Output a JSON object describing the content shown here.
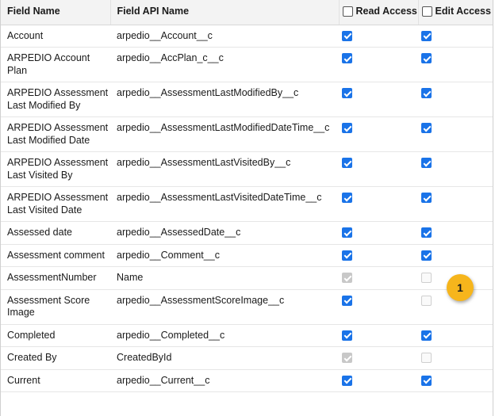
{
  "header": {
    "field_name": "Field Name",
    "field_api_name": "Field API Name",
    "read_access": "Read Access",
    "edit_access": "Edit Access"
  },
  "rows": [
    {
      "name": "Account",
      "api": "arpedio__Account__c",
      "read": true,
      "edit": true,
      "read_disabled": false,
      "edit_disabled": false
    },
    {
      "name": "ARPEDIO Account Plan",
      "api": "arpedio__AccPlan_c__c",
      "read": true,
      "edit": true,
      "read_disabled": false,
      "edit_disabled": false
    },
    {
      "name": "ARPEDIO Assessment Last Modified By",
      "api": "arpedio__AssessmentLastModifiedBy__c",
      "read": true,
      "edit": true,
      "read_disabled": false,
      "edit_disabled": false
    },
    {
      "name": "ARPEDIO Assessment Last Modified Date",
      "api": "arpedio__AssessmentLastModifiedDateTime__c",
      "read": true,
      "edit": true,
      "read_disabled": false,
      "edit_disabled": false
    },
    {
      "name": "ARPEDIO Assessment Last Visited By",
      "api": "arpedio__AssessmentLastVisitedBy__c",
      "read": true,
      "edit": true,
      "read_disabled": false,
      "edit_disabled": false
    },
    {
      "name": "ARPEDIO Assessment Last Visited Date",
      "api": "arpedio__AssessmentLastVisitedDateTime__c",
      "read": true,
      "edit": true,
      "read_disabled": false,
      "edit_disabled": false
    },
    {
      "name": "Assessed date",
      "api": "arpedio__AssessedDate__c",
      "read": true,
      "edit": true,
      "read_disabled": false,
      "edit_disabled": false
    },
    {
      "name": "Assessment comment",
      "api": "arpedio__Comment__c",
      "read": true,
      "edit": true,
      "read_disabled": false,
      "edit_disabled": false
    },
    {
      "name": "AssessmentNumber",
      "api": "Name",
      "read": true,
      "edit": false,
      "read_disabled": true,
      "edit_disabled": true
    },
    {
      "name": "Assessment Score Image",
      "api": "arpedio__AssessmentScoreImage__c",
      "read": true,
      "edit": false,
      "read_disabled": false,
      "edit_disabled": true
    },
    {
      "name": "Completed",
      "api": "arpedio__Completed__c",
      "read": true,
      "edit": true,
      "read_disabled": false,
      "edit_disabled": false
    },
    {
      "name": "Created By",
      "api": "CreatedById",
      "read": true,
      "edit": false,
      "read_disabled": true,
      "edit_disabled": true
    },
    {
      "name": "Current",
      "api": "arpedio__Current__c",
      "read": true,
      "edit": true,
      "read_disabled": false,
      "edit_disabled": false
    }
  ],
  "callout": {
    "label": "1"
  }
}
